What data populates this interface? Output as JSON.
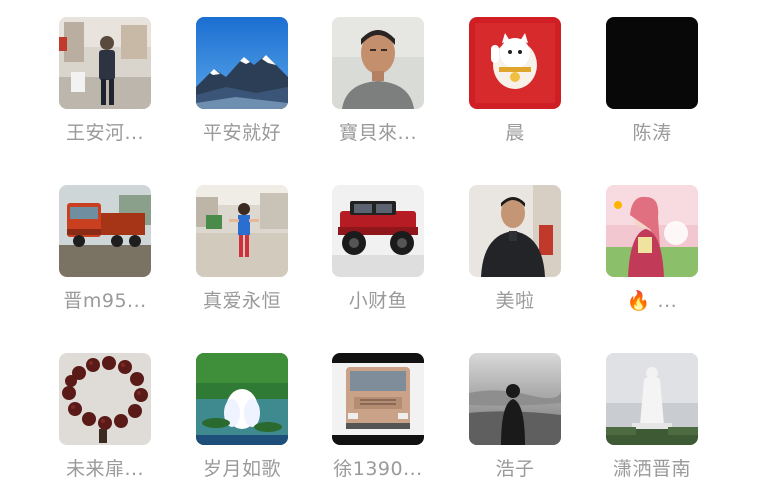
{
  "contacts": [
    {
      "name": "王安河...",
      "avatar": "man-in-room-photo"
    },
    {
      "name": "平安就好",
      "avatar": "snow-mountain-photo"
    },
    {
      "name": "寶貝來...",
      "avatar": "man-portrait-photo"
    },
    {
      "name": "晨",
      "avatar": "lucky-cat-red-photo"
    },
    {
      "name": "陈涛",
      "avatar": "black-photo"
    },
    {
      "name": "晋m95...",
      "avatar": "red-truck-photo"
    },
    {
      "name": "真爱永恒",
      "avatar": "child-playing-photo"
    },
    {
      "name": "小财鱼",
      "avatar": "red-jeep-photo"
    },
    {
      "name": "美啦",
      "avatar": "man-dark-jacket-photo"
    },
    {
      "name": "🔥 ...",
      "avatar": "girl-cartoon-photo"
    },
    {
      "name": "未来扉...",
      "avatar": "prayer-beads-photo"
    },
    {
      "name": "岁月如歌",
      "avatar": "lotus-nature-photo"
    },
    {
      "name": "徐1390...",
      "avatar": "truck-cab-photo"
    },
    {
      "name": "浩子",
      "avatar": "person-silhouette-photo"
    },
    {
      "name": "潇洒晋南",
      "avatar": "guanyin-statue-photo"
    }
  ]
}
